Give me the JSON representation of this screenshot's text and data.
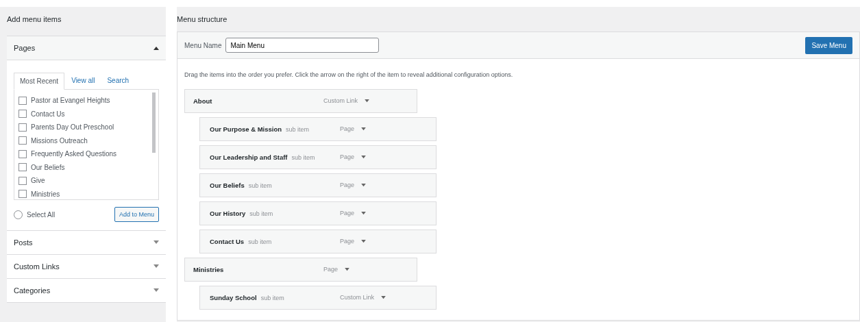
{
  "left": {
    "title": "Add menu items",
    "sections": [
      {
        "label": "Pages",
        "expanded": true
      },
      {
        "label": "Posts",
        "expanded": false
      },
      {
        "label": "Custom Links",
        "expanded": false
      },
      {
        "label": "Categories",
        "expanded": false
      }
    ],
    "tabs": [
      {
        "label": "Most Recent",
        "selected": true
      },
      {
        "label": "View all",
        "selected": false
      },
      {
        "label": "Search",
        "selected": false
      }
    ],
    "pages": [
      {
        "label": "Pastor at Evangel Heights",
        "checked": false
      },
      {
        "label": "Contact Us",
        "checked": false
      },
      {
        "label": "Parents Day Out Preschool",
        "checked": false
      },
      {
        "label": "Missions Outreach",
        "checked": false
      },
      {
        "label": "Frequently Asked Questions",
        "checked": false
      },
      {
        "label": "Our Beliefs",
        "checked": false
      },
      {
        "label": "Give",
        "checked": false
      },
      {
        "label": "Ministries",
        "checked": false
      }
    ],
    "select_all": {
      "label": "Select All",
      "checked": false
    },
    "add_button": "Add to Menu"
  },
  "right": {
    "title": "Menu structure",
    "menu_name_label": "Menu Name",
    "menu_name": "Main Menu",
    "save_button": "Save Menu",
    "instructions": "Drag the items into the order you prefer. Click the arrow on the right of the item to reveal additional configuration options.",
    "items": [
      {
        "title": "About",
        "type": "Custom Link",
        "children": [
          {
            "title": "Our Purpose & Mission",
            "sub": "sub item",
            "type": "Page"
          },
          {
            "title": "Our Leadership and Staff",
            "sub": "sub item",
            "type": "Page"
          },
          {
            "title": "Our Beliefs",
            "sub": "sub item",
            "type": "Page"
          },
          {
            "title": "Our History",
            "sub": "sub item",
            "type": "Page"
          },
          {
            "title": "Contact Us",
            "sub": "sub item",
            "type": "Page"
          }
        ]
      },
      {
        "title": "Ministries",
        "type": "Page",
        "children": [
          {
            "title": "Sunday School",
            "sub": "sub item",
            "type": "Custom Link"
          }
        ]
      }
    ]
  }
}
